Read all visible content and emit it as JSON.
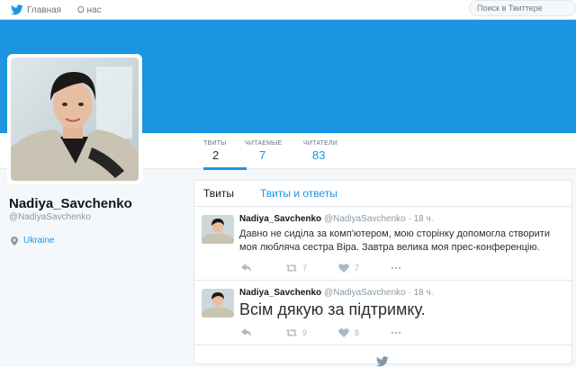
{
  "nav": {
    "home_label": "Главная",
    "about_label": "О нас",
    "search_placeholder": "Поиск в Твиттере"
  },
  "colors": {
    "brand": "#1b95e0",
    "header_background": "#1b95e0",
    "page_background": "#f5f8fa"
  },
  "stats": [
    {
      "label": "ТВИТЫ",
      "value": "2"
    },
    {
      "label": "ЧИТАЕМЫЕ",
      "value": "7"
    },
    {
      "label": "ЧИТАТЕЛИ",
      "value": "83"
    }
  ],
  "profile": {
    "name": "Nadiya_Savchenko",
    "handle": "@NadiyaSavchenko",
    "location": "Ukraine"
  },
  "timeline": {
    "tabs": [
      "Твиты",
      "Твиты и ответы"
    ],
    "tweets": [
      {
        "name": "Nadiya_Savchenko",
        "handle": "@NadiyaSavchenko",
        "time": "· 18 ч.",
        "text": "Давно не сиділа за комп'ютером, мою сторінку допомогла створити моя люблячa сестра Віра. Завтра велика моя прес-конференцію.",
        "retweets": "7",
        "likes": "7"
      },
      {
        "name": "Nadiya_Savchenko",
        "handle": "@NadiyaSavchenko",
        "time": "· 18 ч.",
        "text": "Всім дякую за підтримку.",
        "retweets": "9",
        "likes": "8"
      }
    ]
  }
}
